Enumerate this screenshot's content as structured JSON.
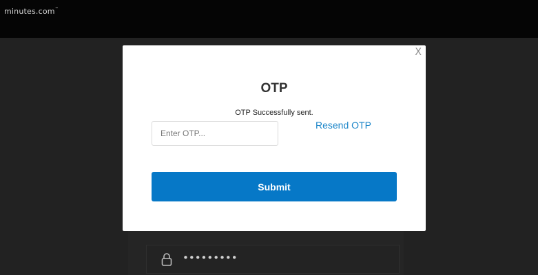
{
  "header": {
    "logo_text": "minutes.com",
    "logo_mark": "™"
  },
  "background_form": {
    "password_mask": "•••••••••",
    "lock_icon": "lock-icon"
  },
  "modal": {
    "close_label": "X",
    "title": "OTP",
    "message": "OTP Successfully sent.",
    "otp_input": {
      "placeholder": "Enter OTP...",
      "value": ""
    },
    "resend_label": "Resend OTP",
    "submit_label": "Submit"
  },
  "colors": {
    "accent": "#0678c7",
    "link": "#1c86c9",
    "overlay": "#222222",
    "topbar": "#050505"
  }
}
